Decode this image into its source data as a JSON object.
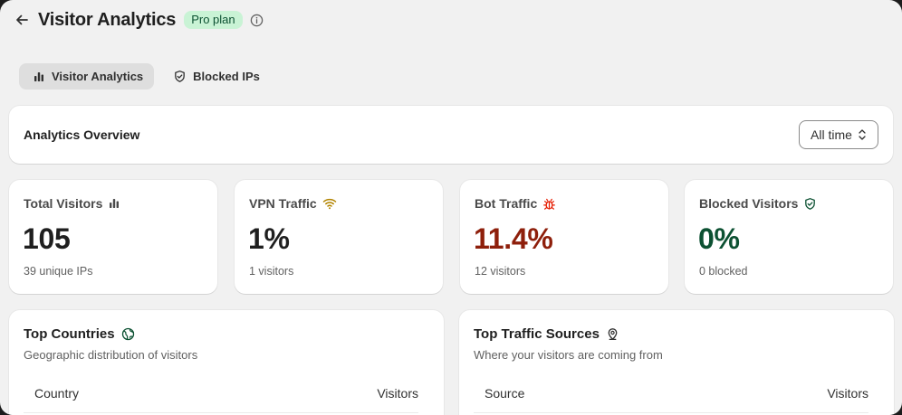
{
  "header": {
    "title": "Visitor Analytics",
    "badge": "Pro plan"
  },
  "tabs": [
    {
      "label": "Visitor Analytics",
      "icon": "bar-chart-icon",
      "active": true
    },
    {
      "label": "Blocked IPs",
      "icon": "shield-icon",
      "active": false
    }
  ],
  "overview": {
    "title": "Analytics Overview",
    "range_selected": "All time"
  },
  "stats": [
    {
      "label": "Total Visitors",
      "value": "105",
      "sub": "39 unique IPs",
      "icon": "bar-chart-icon"
    },
    {
      "label": "VPN Traffic",
      "value": "1%",
      "sub": "1 visitors",
      "icon": "wifi-icon",
      "icon_color": "#b28400"
    },
    {
      "label": "Bot Traffic",
      "value": "11.4%",
      "sub": "12 visitors",
      "icon": "bug-icon",
      "icon_color": "#e51c00",
      "value_color": "#8e1f0b"
    },
    {
      "label": "Blocked Visitors",
      "value": "0%",
      "sub": "0 blocked",
      "icon": "shield-check-icon",
      "icon_color": "#0c5132",
      "value_color": "#0c5132"
    }
  ],
  "countries": {
    "title": "Top Countries",
    "subtitle": "Geographic distribution of visitors",
    "columns": [
      "Country",
      "Visitors"
    ],
    "icon": "globe-icon"
  },
  "sources": {
    "title": "Top Traffic Sources",
    "subtitle": "Where your visitors are coming from",
    "columns": [
      "Source",
      "Visitors"
    ],
    "icon": "location-pin-icon"
  },
  "colors": {
    "badge_bg": "#c9f3d5",
    "badge_text": "#0c5132",
    "page_bg": "#f1f1f1",
    "active_tab_bg": "#dedede"
  }
}
